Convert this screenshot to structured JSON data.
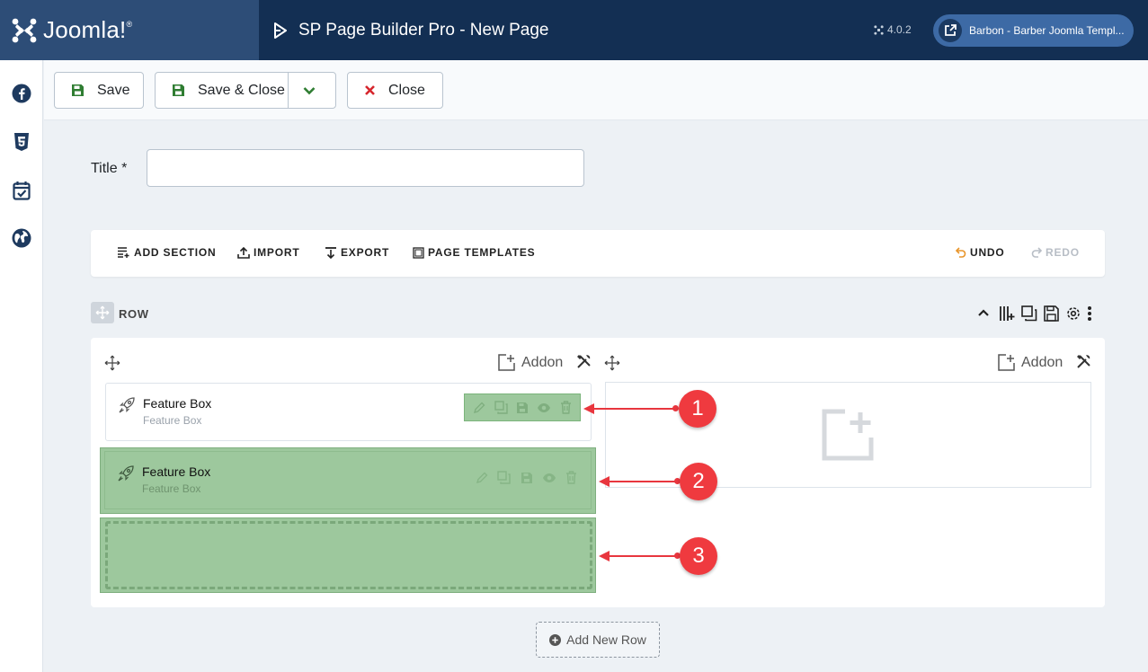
{
  "header": {
    "brand": "Joomla!",
    "brand_reg": "®",
    "page_title": "SP Page Builder Pro - New Page",
    "version": "4.0.2",
    "site_button": "Barbon - Barber Joomla Templ..."
  },
  "sidebar": {
    "items": [
      {
        "icon": "facebook-icon"
      },
      {
        "icon": "css3-icon"
      },
      {
        "icon": "calendar-check-icon"
      },
      {
        "icon": "globe-icon"
      }
    ]
  },
  "toolbar": {
    "save": "Save",
    "save_close": "Save & Close",
    "close": "Close"
  },
  "form": {
    "title_label": "Title *",
    "title_value": ""
  },
  "builder": {
    "add_section": "ADD SECTION",
    "import": "IMPORT",
    "export": "EXPORT",
    "page_templates": "PAGE TEMPLATES",
    "undo": "UNDO",
    "redo": "REDO"
  },
  "row": {
    "label": "ROW",
    "columns": [
      {
        "addon_label": "Addon",
        "addons": [
          {
            "title": "Feature Box",
            "subtitle": "Feature Box"
          },
          {
            "title": "Feature Box",
            "subtitle": "Feature Box"
          }
        ]
      },
      {
        "addon_label": "Addon",
        "addons": []
      }
    ]
  },
  "callouts": [
    "1",
    "2",
    "3"
  ],
  "add_row": "Add New Row",
  "colors": {
    "header_bg": "#132f53",
    "brand_bg": "#2d4d77",
    "highlight_green": "#9dc89d",
    "callout_red": "#ef3a3f",
    "undo_orange": "#e8952b",
    "save_green": "#2f7d32",
    "close_red": "#d6262d"
  }
}
